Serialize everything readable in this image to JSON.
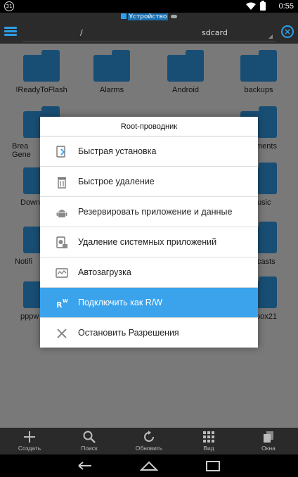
{
  "status_bar": {
    "notification_count": "31",
    "time": "0:55"
  },
  "header": {
    "storage_tab": "Устройство",
    "path_root": "/",
    "path_current": "sdcard"
  },
  "folders": [
    {
      "name": "!ReadyToFlash"
    },
    {
      "name": "Alarms"
    },
    {
      "name": "Android"
    },
    {
      "name": "backups"
    },
    {
      "name": "Brea"
    },
    {
      "name": "Gene"
    },
    {
      "name": "ments"
    },
    {
      "name": "Down"
    },
    {
      "name": "usic"
    },
    {
      "name": "Notifi"
    },
    {
      "name": "casts"
    },
    {
      "name": "pppw"
    },
    {
      "name": "box21"
    }
  ],
  "dialog": {
    "title": "Root-проводник",
    "items": [
      {
        "label": "Быстрая установка",
        "icon": "install-icon"
      },
      {
        "label": "Быстрое удаление",
        "icon": "trash-icon"
      },
      {
        "label": "Резервировать приложение и данные",
        "icon": "android-backup-icon"
      },
      {
        "label": "Удаление системных приложений",
        "icon": "system-app-remove-icon"
      },
      {
        "label": "Автозагрузка",
        "icon": "autostart-icon"
      },
      {
        "label": "Подключить как R/W",
        "icon": "rw-mount-icon",
        "selected": true
      },
      {
        "label": "Остановить Разрешения",
        "icon": "close-x-icon"
      }
    ]
  },
  "toolbar": {
    "create": "Создать",
    "search": "Поиск",
    "refresh": "Обновить",
    "view": "Вид",
    "windows": "Окна"
  },
  "colors": {
    "accent": "#2e9ee8",
    "selected_item": "#3aa3ec",
    "folder": "#2f8ed4"
  }
}
